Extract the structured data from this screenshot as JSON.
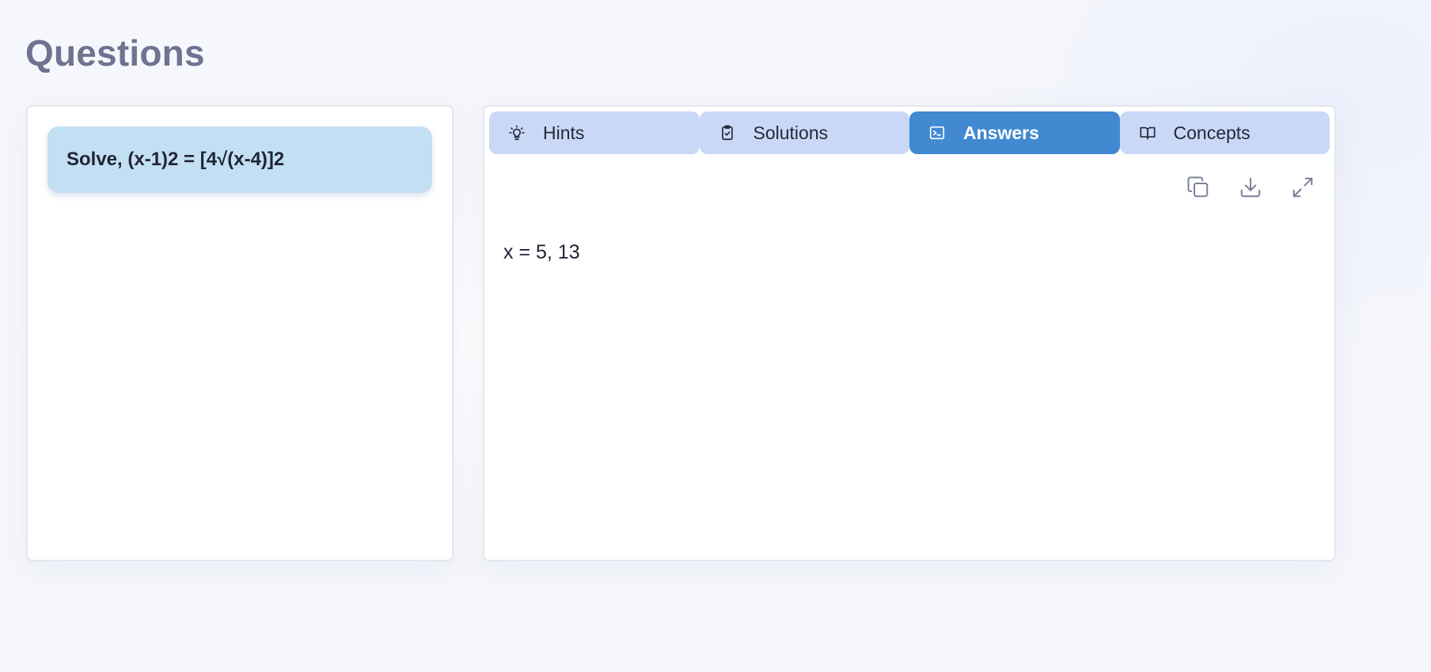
{
  "page": {
    "title": "Questions"
  },
  "question": {
    "text": "Solve, (x-1)2 = [4√(x-4)]2"
  },
  "tabs": [
    {
      "label": "Hints",
      "icon": "lightbulb-icon",
      "active": false
    },
    {
      "label": "Solutions",
      "icon": "clipboard-check-icon",
      "active": false
    },
    {
      "label": "Answers",
      "icon": "terminal-icon",
      "active": true
    },
    {
      "label": "Concepts",
      "icon": "open-book-icon",
      "active": false
    }
  ],
  "toolbar": {
    "copy_icon": "copy-icon",
    "download_icon": "download-icon",
    "expand_icon": "expand-icon"
  },
  "answer": {
    "text": "x = 5, 13"
  },
  "colors": {
    "title": "#6f7390",
    "tab_bg": "#c9d8f6",
    "tab_active_bg": "#4289d2",
    "question_card_bg": "#c3dff3",
    "icon_gray": "#7a8099"
  }
}
